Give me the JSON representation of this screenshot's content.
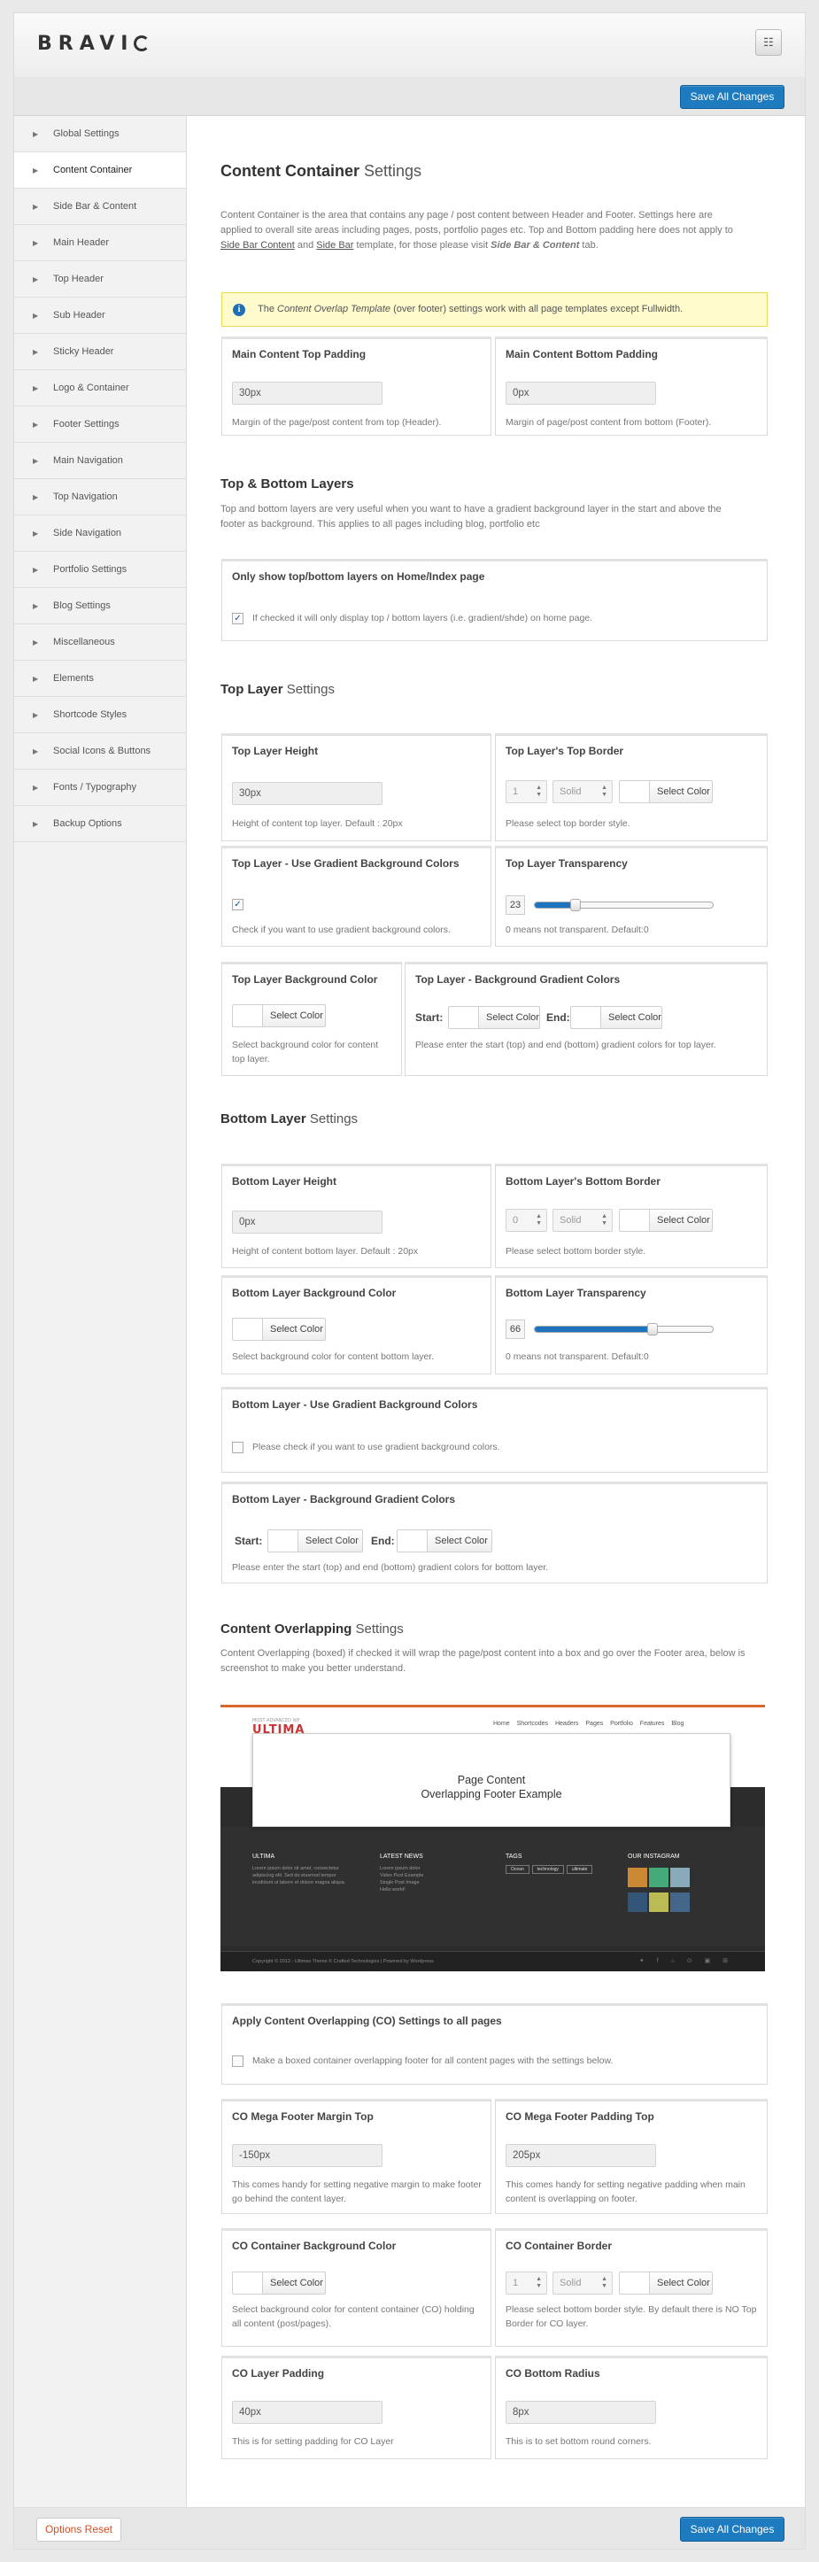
{
  "header": {
    "logo": "BRAVI",
    "icon": "theme-options-icon"
  },
  "save_all": "Save All Changes",
  "options_reset": "Options Reset",
  "sidebar": {
    "items": [
      {
        "label": "Global Settings"
      },
      {
        "label": "Content Container",
        "active": true
      },
      {
        "label": "Side Bar & Content"
      },
      {
        "label": "Main Header"
      },
      {
        "label": "Top Header"
      },
      {
        "label": "Sub Header"
      },
      {
        "label": "Sticky Header"
      },
      {
        "label": "Logo & Container"
      },
      {
        "label": "Footer Settings"
      },
      {
        "label": "Main Navigation"
      },
      {
        "label": "Top Navigation"
      },
      {
        "label": "Side Navigation"
      },
      {
        "label": "Portfolio Settings"
      },
      {
        "label": "Blog Settings"
      },
      {
        "label": "Miscellaneous"
      },
      {
        "label": "Elements"
      },
      {
        "label": "Shortcode Styles"
      },
      {
        "label": "Social Icons & Buttons"
      },
      {
        "label": "Fonts / Typography"
      },
      {
        "label": "Backup Options"
      }
    ]
  },
  "page": {
    "title_bold": "Content Container",
    "title_light": "Settings",
    "intro_1": "Content Container is the area that contains any page / post content between Header and Footer. Settings here are applied to overall site areas including pages, posts, portfolio pages etc. Top and Bottom padding here does not apply to ",
    "intro_link1": "Side Bar Content",
    "intro_and": " and ",
    "intro_link2": "Side Bar",
    "intro_2": " template, for those please visit ",
    "intro_em": "Side Bar & Content",
    "intro_3": " tab.",
    "notice_pre": "The ",
    "notice_em": "Content Overlap Template",
    "notice_post": " (over footer) settings work with all page templates except Fullwidth."
  },
  "padding": {
    "top": {
      "title": "Main Content Top Padding",
      "value": "30px",
      "help": "Margin of the page/post content from top (Header)."
    },
    "bottom": {
      "title": "Main Content Bottom Padding",
      "value": "0px",
      "help": "Margin of page/post content from bottom (Footer)."
    }
  },
  "layers": {
    "title": "Top & Bottom Layers",
    "desc": "Top and bottom layers are very useful when you want to have a gradient background layer in the start and above the footer as background. This applies to all pages including blog, portfolio etc",
    "home_only": {
      "title": "Only show top/bottom layers on Home/Index page",
      "help": "If checked it will only display top / bottom layers (i.e. gradient/shde) on home page.",
      "checked": true
    }
  },
  "top_layer": {
    "title_bold": "Top Layer",
    "title_light": "Settings",
    "height": {
      "title": "Top Layer Height",
      "value": "30px",
      "help": "Height of content top layer. Default : 20px"
    },
    "border": {
      "title": "Top Layer's Top Border",
      "width": "1",
      "style": "Solid",
      "color_label": "Select Color",
      "help": "Please select top border style."
    },
    "gradient_use": {
      "title": "Top Layer - Use Gradient Background Colors",
      "checked": true,
      "help": "Check if you want to use gradient background colors."
    },
    "transparency": {
      "title": "Top Layer Transparency",
      "value": "23",
      "fraction": 0.23,
      "help": "0 means not transparent. Default:0"
    },
    "bg_color": {
      "title": "Top Layer Background Color",
      "color_label": "Select Color",
      "help": "Select background color for content top layer."
    },
    "gradient": {
      "title": "Top Layer - Background Gradient Colors",
      "start": "Start:",
      "end": "End:",
      "color_label": "Select Color",
      "help": "Please enter the start (top) and end (bottom) gradient colors for top layer."
    }
  },
  "bottom_layer": {
    "title_bold": "Bottom Layer",
    "title_light": "Settings",
    "height": {
      "title": "Bottom Layer Height",
      "value": "0px",
      "help": "Height of content bottom layer. Default : 20px"
    },
    "border": {
      "title": "Bottom Layer's Bottom Border",
      "width": "0",
      "style": "Solid",
      "color_label": "Select Color",
      "help": "Please select bottom border style."
    },
    "bg_color": {
      "title": "Bottom Layer Background Color",
      "color_label": "Select Color",
      "help": "Select background color for content bottom layer."
    },
    "transparency": {
      "title": "Bottom Layer Transparency",
      "value": "66",
      "fraction": 0.66,
      "help": "0 means not transparent. Default:0"
    },
    "gradient_use": {
      "title": "Bottom Layer - Use Gradient Background Colors",
      "checked": false,
      "help": "Please check if you want to use gradient background colors."
    },
    "gradient": {
      "title": "Bottom Layer - Background Gradient Colors",
      "start": "Start:",
      "end": "End:",
      "color_label": "Select Color",
      "help": "Please enter the start (top) and end (bottom) gradient colors for bottom layer."
    }
  },
  "overlap": {
    "title_bold": "Content Overlapping",
    "title_light": "Settings",
    "desc": "Content Overlapping (boxed) if checked it will wrap the page/post content into a box and go over the Footer area, below is screenshot to make you better understand.",
    "preview": {
      "logo": "ULTIMA",
      "logo_small": "MOST ADVANCED WP",
      "nav": "Home Shortcodes Headers Pages Portfolio Features Blog",
      "card_line1": "Page Content",
      "card_line2": "Overlapping Footer Example",
      "col1_text": "Lorem ipsum dolor sit amet, consectetur adipiscing elit. Sed do eiusmod tempor incididunt ut labore et dolore magna aliqua.",
      "col2_title": "LATEST NEWS",
      "col2_items": [
        "Lorem ipsum dolor",
        "Video Post Example",
        "Single Post Image",
        "Hello world!"
      ],
      "col3_title": "TAGS",
      "tags": [
        "Ocean",
        "technology",
        "ultimate"
      ],
      "col4_title": "OUR INSTAGRAM",
      "copyright": "Copyright © 2013 - Ultimas Theme © Crafted Technologies | Powered by Wordpress"
    },
    "apply_all": {
      "title": "Apply Content Overlapping (CO) Settings to all pages",
      "checked": false,
      "help": "Make a boxed container overlapping footer for all content pages with the settings below."
    },
    "margin_top": {
      "title": "CO Mega Footer Margin Top",
      "value": "-150px",
      "help": "This comes handy for setting negative margin to make footer go behind the content layer."
    },
    "padding_top": {
      "title": "CO Mega Footer Padding Top",
      "value": "205px",
      "help": "This comes handy for setting negative padding when main content is overlapping on footer."
    },
    "container_bg": {
      "title": "CO Container Background Color",
      "color_label": "Select Color",
      "help": "Select background color for content container (CO) holding all content (post/pages)."
    },
    "container_border": {
      "title": "CO Container Border",
      "width": "1",
      "style": "Solid",
      "color_label": "Select Color",
      "help": "Please select bottom border style. By default there is NO Top Border for CO layer."
    },
    "layer_padding": {
      "title": "CO Layer Padding",
      "value": "40px",
      "help": "This is for setting padding for CO Layer"
    },
    "bottom_radius": {
      "title": "CO Bottom Radius",
      "value": "8px",
      "help": "This is to set bottom round corners."
    }
  }
}
